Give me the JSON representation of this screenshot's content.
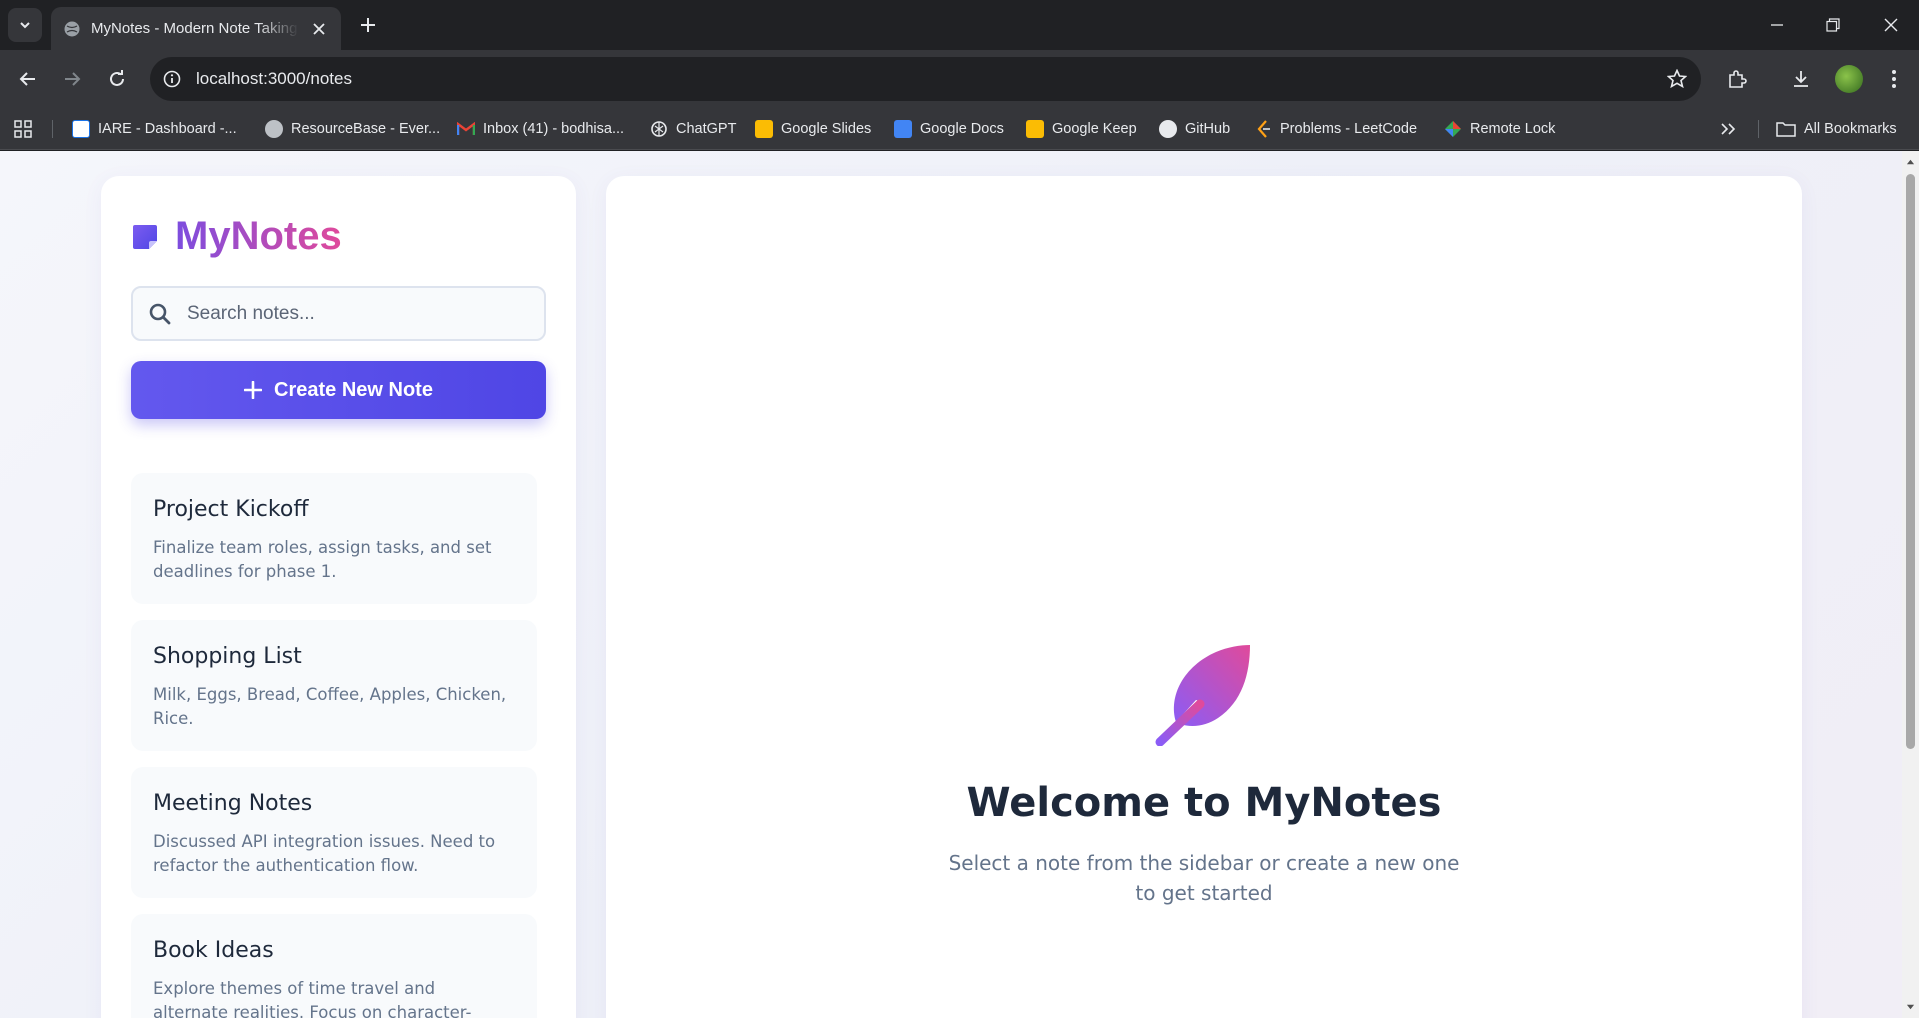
{
  "browser": {
    "tab_title": "MyNotes - Modern Note Taking App",
    "url": "localhost:3000/notes",
    "bookmarks": [
      {
        "label": "IARE - Dashboard -...",
        "icon": "iare-icon",
        "color": "#1a73e8"
      },
      {
        "label": "ResourceBase - Ever...",
        "icon": "globe-icon",
        "color": "#bdc1c6"
      },
      {
        "label": "Inbox (41) - bodhisa...",
        "icon": "gmail-icon",
        "color": "#ea4335"
      },
      {
        "label": "ChatGPT",
        "icon": "chatgpt-icon",
        "color": "#e8eaed"
      },
      {
        "label": "Google Slides",
        "icon": "slides-icon",
        "color": "#fbbc04"
      },
      {
        "label": "Google Docs",
        "icon": "docs-icon",
        "color": "#4285f4"
      },
      {
        "label": "Google Keep",
        "icon": "keep-icon",
        "color": "#fbbc04"
      },
      {
        "label": "GitHub",
        "icon": "github-icon",
        "color": "#e8eaed"
      },
      {
        "label": "Problems - LeetCode",
        "icon": "leetcode-icon",
        "color": "#ffa116"
      },
      {
        "label": "Remote Lock",
        "icon": "remote-lock-icon",
        "color": "#34a853"
      }
    ],
    "all_bookmarks_label": "All Bookmarks"
  },
  "app": {
    "logo_text": "MyNotes",
    "search_placeholder": "Search notes...",
    "create_button_label": "Create New Note",
    "notes": [
      {
        "title": "Project Kickoff",
        "preview": "Finalize team roles, assign tasks, and set deadlines for phase 1."
      },
      {
        "title": "Shopping List",
        "preview": "Milk, Eggs, Bread, Coffee, Apples, Chicken, Rice."
      },
      {
        "title": "Meeting Notes",
        "preview": "Discussed API integration issues. Need to refactor the authentication flow."
      },
      {
        "title": "Book Ideas",
        "preview": "Explore themes of time travel and alternate realities. Focus on character-driven..."
      }
    ],
    "welcome_title": "Welcome to MyNotes",
    "welcome_subtitle": "Select a note from the sidebar or create a new one to get started"
  },
  "colors": {
    "accent": "#4f46e5",
    "logo_gradient_start": "#7c4ddf",
    "logo_gradient_end": "#e04a9b"
  }
}
